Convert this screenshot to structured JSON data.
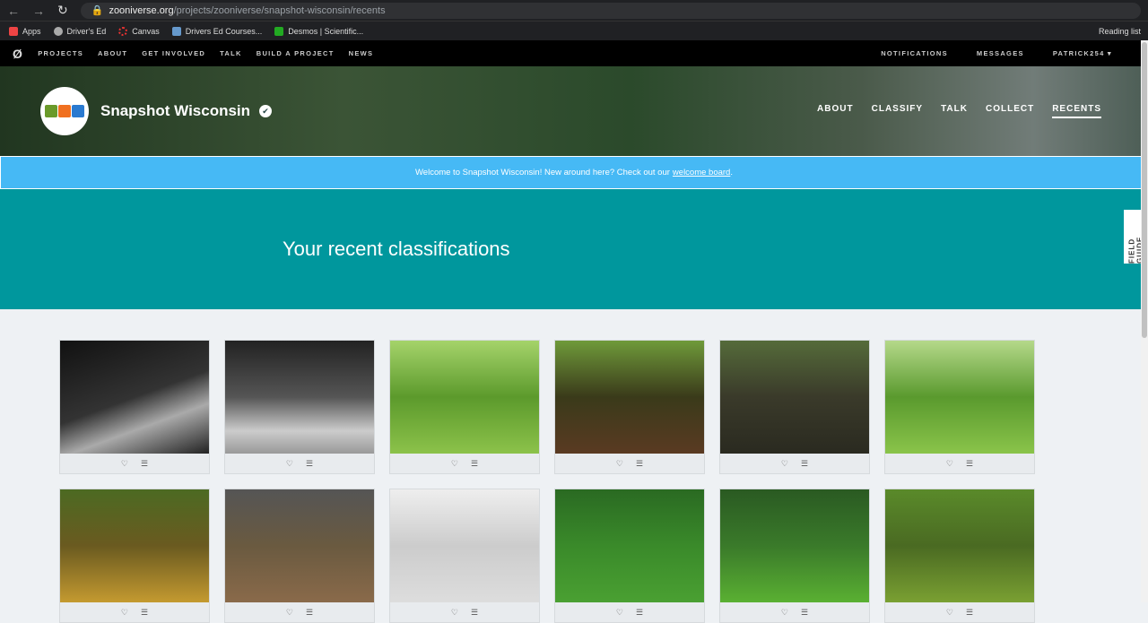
{
  "browser": {
    "host": "zooniverse.org",
    "path": "/projects/zooniverse/snapshot-wisconsin/recents",
    "bookmarks": [
      "Apps",
      "Driver's Ed",
      "Canvas",
      "Drivers Ed Courses...",
      "Desmos | Scientific..."
    ],
    "reading_list": "Reading list"
  },
  "zoonav": {
    "items": [
      "PROJECTS",
      "ABOUT",
      "GET INVOLVED",
      "TALK",
      "BUILD A PROJECT",
      "NEWS"
    ],
    "right": [
      "NOTIFICATIONS",
      "MESSAGES",
      "PATRICK254 ▾"
    ]
  },
  "project": {
    "title": "Snapshot Wisconsin",
    "nav": [
      "ABOUT",
      "CLASSIFY",
      "TALK",
      "COLLECT",
      "RECENTS"
    ]
  },
  "banner": {
    "text": "Welcome to Snapshot Wisconsin! New around here? Check out our",
    "link": "welcome board",
    "end": "."
  },
  "heading": "Your recent classifications",
  "field_guide": "FIELD GUIDE",
  "thumbs": [
    {
      "bg": "linear-gradient(160deg,#111,#333 50%,#aaa 70%,#222)"
    },
    {
      "bg": "linear-gradient(180deg,#222,#555 50%,#ccc 80%,#999)"
    },
    {
      "bg": "linear-gradient(180deg,#a5d36a,#5c9a2c 50%,#8cc24a)"
    },
    {
      "bg": "linear-gradient(180deg,#6f9a3a,#3a3a1a 50%,#5a3a22)"
    },
    {
      "bg": "linear-gradient(180deg,#556b3a,#3a3a2a 50%,#2a2a20)"
    },
    {
      "bg": "linear-gradient(180deg,#b5d98a,#5a9a2e 50%,#8ac44a)"
    },
    {
      "bg": "linear-gradient(180deg,#4c6a22,#6a5a20 50%,#c49a30)"
    },
    {
      "bg": "linear-gradient(180deg,#555,#6a5a40 50%,#8a6a4a)"
    },
    {
      "bg": "linear-gradient(180deg,#eee,#ccc 50%,#ddd)"
    },
    {
      "bg": "linear-gradient(180deg,#2a6a22,#3a8a2a 50%,#4aa032)"
    },
    {
      "bg": "linear-gradient(180deg,#2a5a22,#3a7a2a 50%,#5ab032)"
    },
    {
      "bg": "linear-gradient(180deg,#5a8a2a,#4a6a22 50%,#7aa032)"
    }
  ]
}
